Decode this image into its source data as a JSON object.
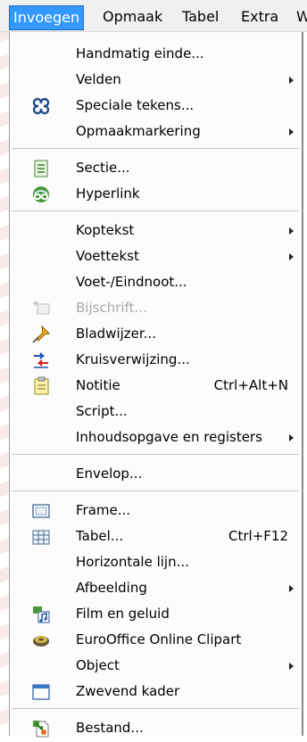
{
  "menubar": {
    "items": [
      {
        "label": "Invoegen",
        "name": "menu-invoegen",
        "active": true
      },
      {
        "label": "Opmaak",
        "name": "menu-opmaak"
      },
      {
        "label": "Tabel",
        "name": "menu-tabel"
      },
      {
        "label": "Extra",
        "name": "menu-extra"
      },
      {
        "label": "W",
        "name": "menu-w"
      }
    ]
  },
  "menu": {
    "items": [
      {
        "type": "item",
        "name": "menu-item-handmatig-einde",
        "label": "Handmatig einde...",
        "icon": ""
      },
      {
        "type": "item",
        "name": "menu-item-velden",
        "label": "Velden",
        "icon": "",
        "submenu": true
      },
      {
        "type": "item",
        "name": "menu-item-speciale-tekens",
        "label": "Speciale tekens...",
        "icon": "special-characters-icon"
      },
      {
        "type": "item",
        "name": "menu-item-opmaakmarkering",
        "label": "Opmaakmarkering",
        "icon": "",
        "submenu": true
      },
      {
        "type": "separator"
      },
      {
        "type": "item",
        "name": "menu-item-sectie",
        "label": "Sectie...",
        "icon": "section-icon"
      },
      {
        "type": "item",
        "name": "menu-item-hyperlink",
        "label": "Hyperlink",
        "icon": "hyperlink-icon"
      },
      {
        "type": "separator"
      },
      {
        "type": "item",
        "name": "menu-item-koptekst",
        "label": "Koptekst",
        "icon": "",
        "submenu": true
      },
      {
        "type": "item",
        "name": "menu-item-voettekst",
        "label": "Voettekst",
        "icon": "",
        "submenu": true
      },
      {
        "type": "item",
        "name": "menu-item-voet-eindnoot",
        "label": "Voet-/Eindnoot...",
        "icon": ""
      },
      {
        "type": "item",
        "name": "menu-item-bijschrift",
        "label": "Bijschrift...",
        "icon": "caption-icon",
        "disabled": true
      },
      {
        "type": "item",
        "name": "menu-item-bladwijzer",
        "label": "Bladwijzer...",
        "icon": "bookmark-pin-icon"
      },
      {
        "type": "item",
        "name": "menu-item-kruisverwijzing",
        "label": "Kruisverwijzing...",
        "icon": "cross-reference-icon"
      },
      {
        "type": "item",
        "name": "menu-item-notitie",
        "label": "Notitie",
        "icon": "note-icon",
        "shortcut": "Ctrl+Alt+N"
      },
      {
        "type": "item",
        "name": "menu-item-script",
        "label": "Script...",
        "icon": ""
      },
      {
        "type": "item",
        "name": "menu-item-inhoudsopgave",
        "label": "Inhoudsopgave en registers",
        "icon": "",
        "submenu": true
      },
      {
        "type": "separator"
      },
      {
        "type": "item",
        "name": "menu-item-envelop",
        "label": "Envelop...",
        "icon": ""
      },
      {
        "type": "separator"
      },
      {
        "type": "item",
        "name": "menu-item-frame",
        "label": "Frame...",
        "icon": "frame-icon"
      },
      {
        "type": "item",
        "name": "menu-item-tabel",
        "label": "Tabel...",
        "icon": "table-icon",
        "shortcut": "Ctrl+F12"
      },
      {
        "type": "item",
        "name": "menu-item-horizontale-lijn",
        "label": "Horizontale lijn...",
        "icon": ""
      },
      {
        "type": "item",
        "name": "menu-item-afbeelding",
        "label": "Afbeelding",
        "icon": "",
        "submenu": true
      },
      {
        "type": "item",
        "name": "menu-item-film-en-geluid",
        "label": "Film en geluid",
        "icon": "movie-sound-icon"
      },
      {
        "type": "item",
        "name": "menu-item-clipart",
        "label": "EuroOffice Online Clipart",
        "icon": "clipart-icon"
      },
      {
        "type": "item",
        "name": "menu-item-object",
        "label": "Object",
        "icon": "",
        "submenu": true
      },
      {
        "type": "item",
        "name": "menu-item-zwevend-kader",
        "label": "Zwevend kader",
        "icon": "floating-frame-icon"
      },
      {
        "type": "separator"
      },
      {
        "type": "item",
        "name": "menu-item-bestand",
        "label": "Bestand...",
        "icon": "insert-file-icon"
      }
    ]
  }
}
